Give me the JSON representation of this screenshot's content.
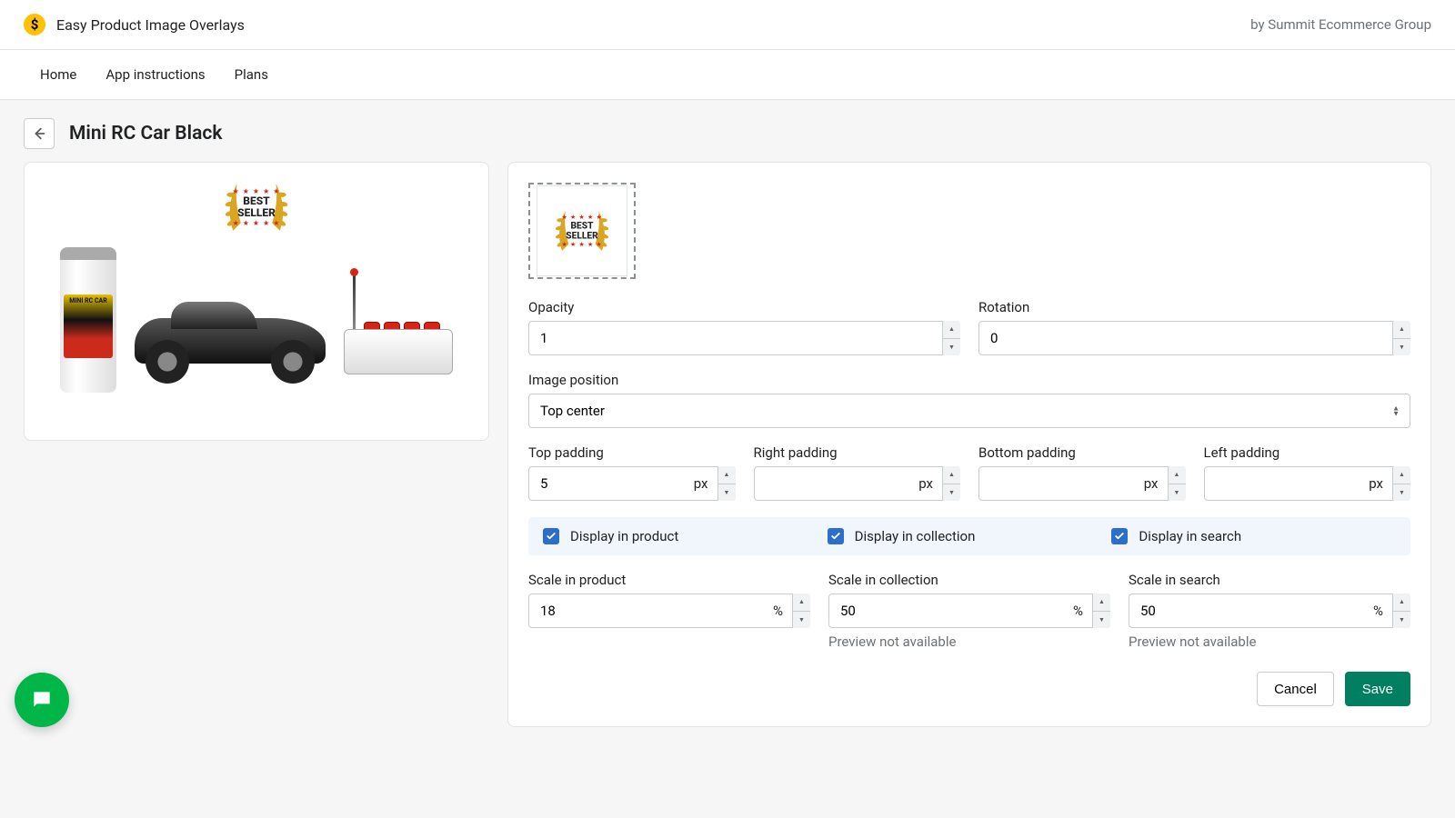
{
  "header": {
    "app_title": "Easy Product Image Overlays",
    "vendor": "by Summit Ecommerce Group"
  },
  "nav": {
    "items": [
      "Home",
      "App instructions",
      "Plans"
    ]
  },
  "page": {
    "title": "Mini RC Car Black"
  },
  "badge": {
    "stars": "★ ★ ★ ★ ★",
    "line1": "BEST",
    "line2": "SELLER"
  },
  "can_label": "MINI RC CAR",
  "fields": {
    "opacity": {
      "label": "Opacity",
      "value": "1"
    },
    "rotation": {
      "label": "Rotation",
      "value": "0"
    },
    "image_position": {
      "label": "Image position",
      "value": "Top center"
    },
    "top_padding": {
      "label": "Top padding",
      "value": "5",
      "unit": "px"
    },
    "right_padding": {
      "label": "Right padding",
      "value": "",
      "unit": "px"
    },
    "bottom_padding": {
      "label": "Bottom padding",
      "value": "",
      "unit": "px"
    },
    "left_padding": {
      "label": "Left padding",
      "value": "",
      "unit": "px"
    }
  },
  "checkboxes": {
    "product": {
      "label": "Display in product",
      "checked": true
    },
    "collection": {
      "label": "Display in collection",
      "checked": true
    },
    "search": {
      "label": "Display in search",
      "checked": true
    }
  },
  "scales": {
    "product": {
      "label": "Scale in product",
      "value": "18",
      "unit": "%"
    },
    "collection": {
      "label": "Scale in collection",
      "value": "50",
      "unit": "%",
      "hint": "Preview not available"
    },
    "search": {
      "label": "Scale in search",
      "value": "50",
      "unit": "%",
      "hint": "Preview not available"
    }
  },
  "actions": {
    "cancel": "Cancel",
    "save": "Save"
  }
}
